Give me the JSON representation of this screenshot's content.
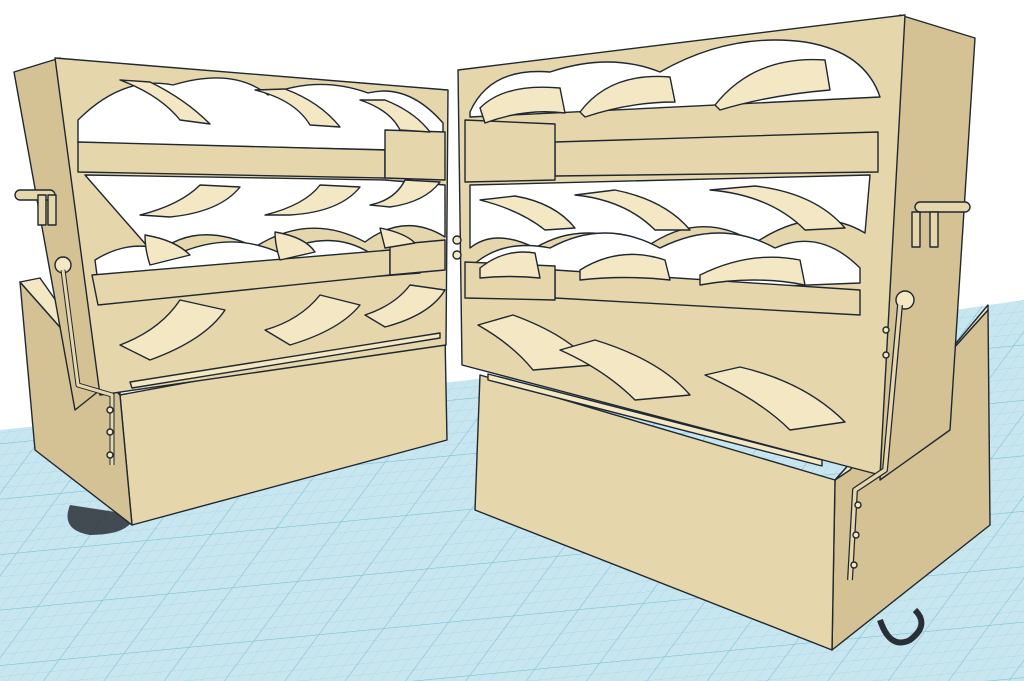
{
  "app": {
    "view": "3d-workplane",
    "colors": {
      "workplane": "#c8e6ef",
      "grid_minor": "#a5d5e4",
      "grid_major": "#7ec1d7",
      "model_face": "#e6d6ac",
      "model_face_dark": "#d4c295",
      "model_face_light": "#f3e7c4",
      "model_edge": "#1f2730",
      "shadow": "#2a2f35",
      "background": "#ffffff"
    }
  },
  "objects": [
    {
      "name": "wine-rack-left",
      "rows": 3,
      "bottles_per_row": 3,
      "cradle_rows": 3
    },
    {
      "name": "wine-rack-right",
      "rows": 3,
      "bottles_per_row": 3,
      "cradle_rows": 3
    }
  ],
  "icons": [
    "hinge-latch-icon",
    "pin-icon"
  ]
}
